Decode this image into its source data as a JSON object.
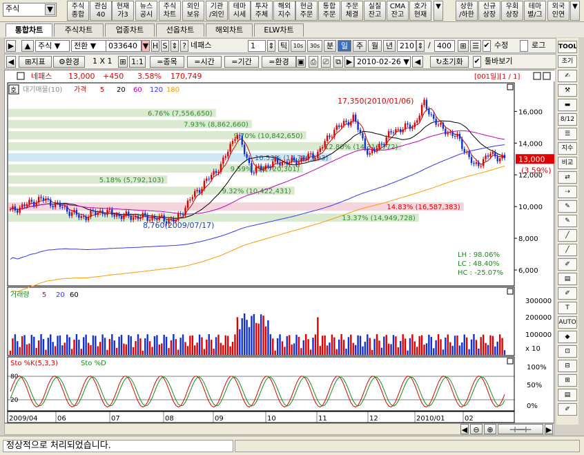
{
  "top": {
    "market": "주식",
    "buttons": [
      "주식\n종합",
      "관심\n40",
      "현재\n가3",
      "뉴스\n공시",
      "주식\n차트",
      "외인\n보유",
      "기관\n/외인",
      "테마\n시세",
      "투자\n주체",
      "해외\n지수",
      "현금\n주문",
      "통합\n주문",
      "주문\n체결",
      "실질\n잔고",
      "CMA\n잔고",
      "호가\n현재",
      "상한\n/하한",
      "신규\n상장",
      "우회\n상장",
      "테마\n별/그",
      "외국\n인연"
    ]
  },
  "tabs": [
    "통합차트",
    "주식차트",
    "업종차트",
    "선옵차트",
    "해외차트",
    "ELW차트"
  ],
  "ctrl1": {
    "type": "주식",
    "mode": "전환",
    "code": "033640",
    "h": "H",
    "s": "S",
    "q": "?",
    "name": "네패스",
    "num": "1",
    "units": [
      "틱",
      "10s",
      "30s",
      "분",
      "일",
      "주",
      "월",
      "년"
    ],
    "count": "210",
    "slash": "/",
    "total": "400",
    "modify": "수정",
    "log": "로그"
  },
  "ctrl2": {
    "indicator": "지표",
    "env": "환경",
    "grid": "1 X 1",
    "btns": [
      "=종목",
      "=시간",
      "=기간",
      "=환경"
    ],
    "date": "2010-02-26",
    "reset": "초기화",
    "tooltip": "툴바보기"
  },
  "header": {
    "name": "네패스",
    "price": "13,000",
    "change": "+450",
    "pct": "3.58%",
    "volume": "170,749",
    "nav": "[001일][1 / 1]"
  },
  "legend_price": {
    "ho": "호",
    "label": "대기매물(10)",
    "price": "가격",
    "ma": [
      "5",
      "20",
      "60",
      "120",
      "180"
    ]
  },
  "legend_vol": {
    "label": "거래량",
    "ma": [
      "5",
      "20",
      "60"
    ]
  },
  "legend_sto": {
    "k": "Sto %K(5,3,3)",
    "d": "Sto %D"
  },
  "right_tools": [
    "TOOL",
    "초기",
    "",
    "",
    "",
    "8/12",
    "",
    "지수",
    "비교",
    "",
    "",
    "",
    "",
    "",
    "",
    "",
    "",
    "",
    "",
    "AUTO",
    "",
    "",
    "",
    "",
    "",
    ""
  ],
  "stats": {
    "lh": "LH :  98.06%",
    "lc": "LC :  48.40%",
    "hc": "HC : -25.07%"
  },
  "status": "정상적으로 처리되었습니다.",
  "chart_data": {
    "type": "candlestick",
    "symbol": "네패스",
    "x_ticks": [
      "2009/04",
      "06",
      "07",
      "08",
      "09",
      "10",
      "11",
      "12",
      "2010/01",
      "02"
    ],
    "y_ticks": [
      6000,
      8000,
      10000,
      12000,
      14000,
      16000
    ],
    "y_labels": [
      "6,000",
      "8,000",
      "10,000",
      "12,000",
      "14,000",
      "16,000"
    ],
    "last_price": "13,000",
    "last_pct": "(3.59%)",
    "annotations": [
      "17,350(2010/01/06)",
      "8,760(2009/07/17)"
    ],
    "volume_profile": [
      {
        "label": "6.76% (7,556,650)",
        "price": 15900,
        "pct": 6.76
      },
      {
        "label": "7.93% (8,862,660)",
        "price": 15200,
        "pct": 7.93
      },
      {
        "label": "9.70% (10,842,650)",
        "price": 14500,
        "pct": 9.7
      },
      {
        "label": "12.80% (14,316,772)",
        "price": 13800,
        "pct": 12.8
      },
      {
        "label": "10.53% (11,780,193)",
        "price": 13100,
        "pct": 10.53
      },
      {
        "label": "9.59% (10,720,301)",
        "price": 12400,
        "pct": 9.59
      },
      {
        "label": "5.18% (5,792,103)",
        "price": 11700,
        "pct": 5.18
      },
      {
        "label": "9.32% (10,422,431)",
        "price": 11000,
        "pct": 9.32
      },
      {
        "label": "14.83% (16,587,383)",
        "price": 10000,
        "pct": 14.83
      },
      {
        "label": "13.37% (14,949,728)",
        "price": 9300,
        "pct": 13.37
      }
    ],
    "volume_ticks": [
      "300000",
      "200000",
      "100000",
      "x 10"
    ],
    "sto_ticks": [
      "100%",
      "50%",
      "0%"
    ],
    "sto_levels": [
      "80",
      "20"
    ]
  }
}
